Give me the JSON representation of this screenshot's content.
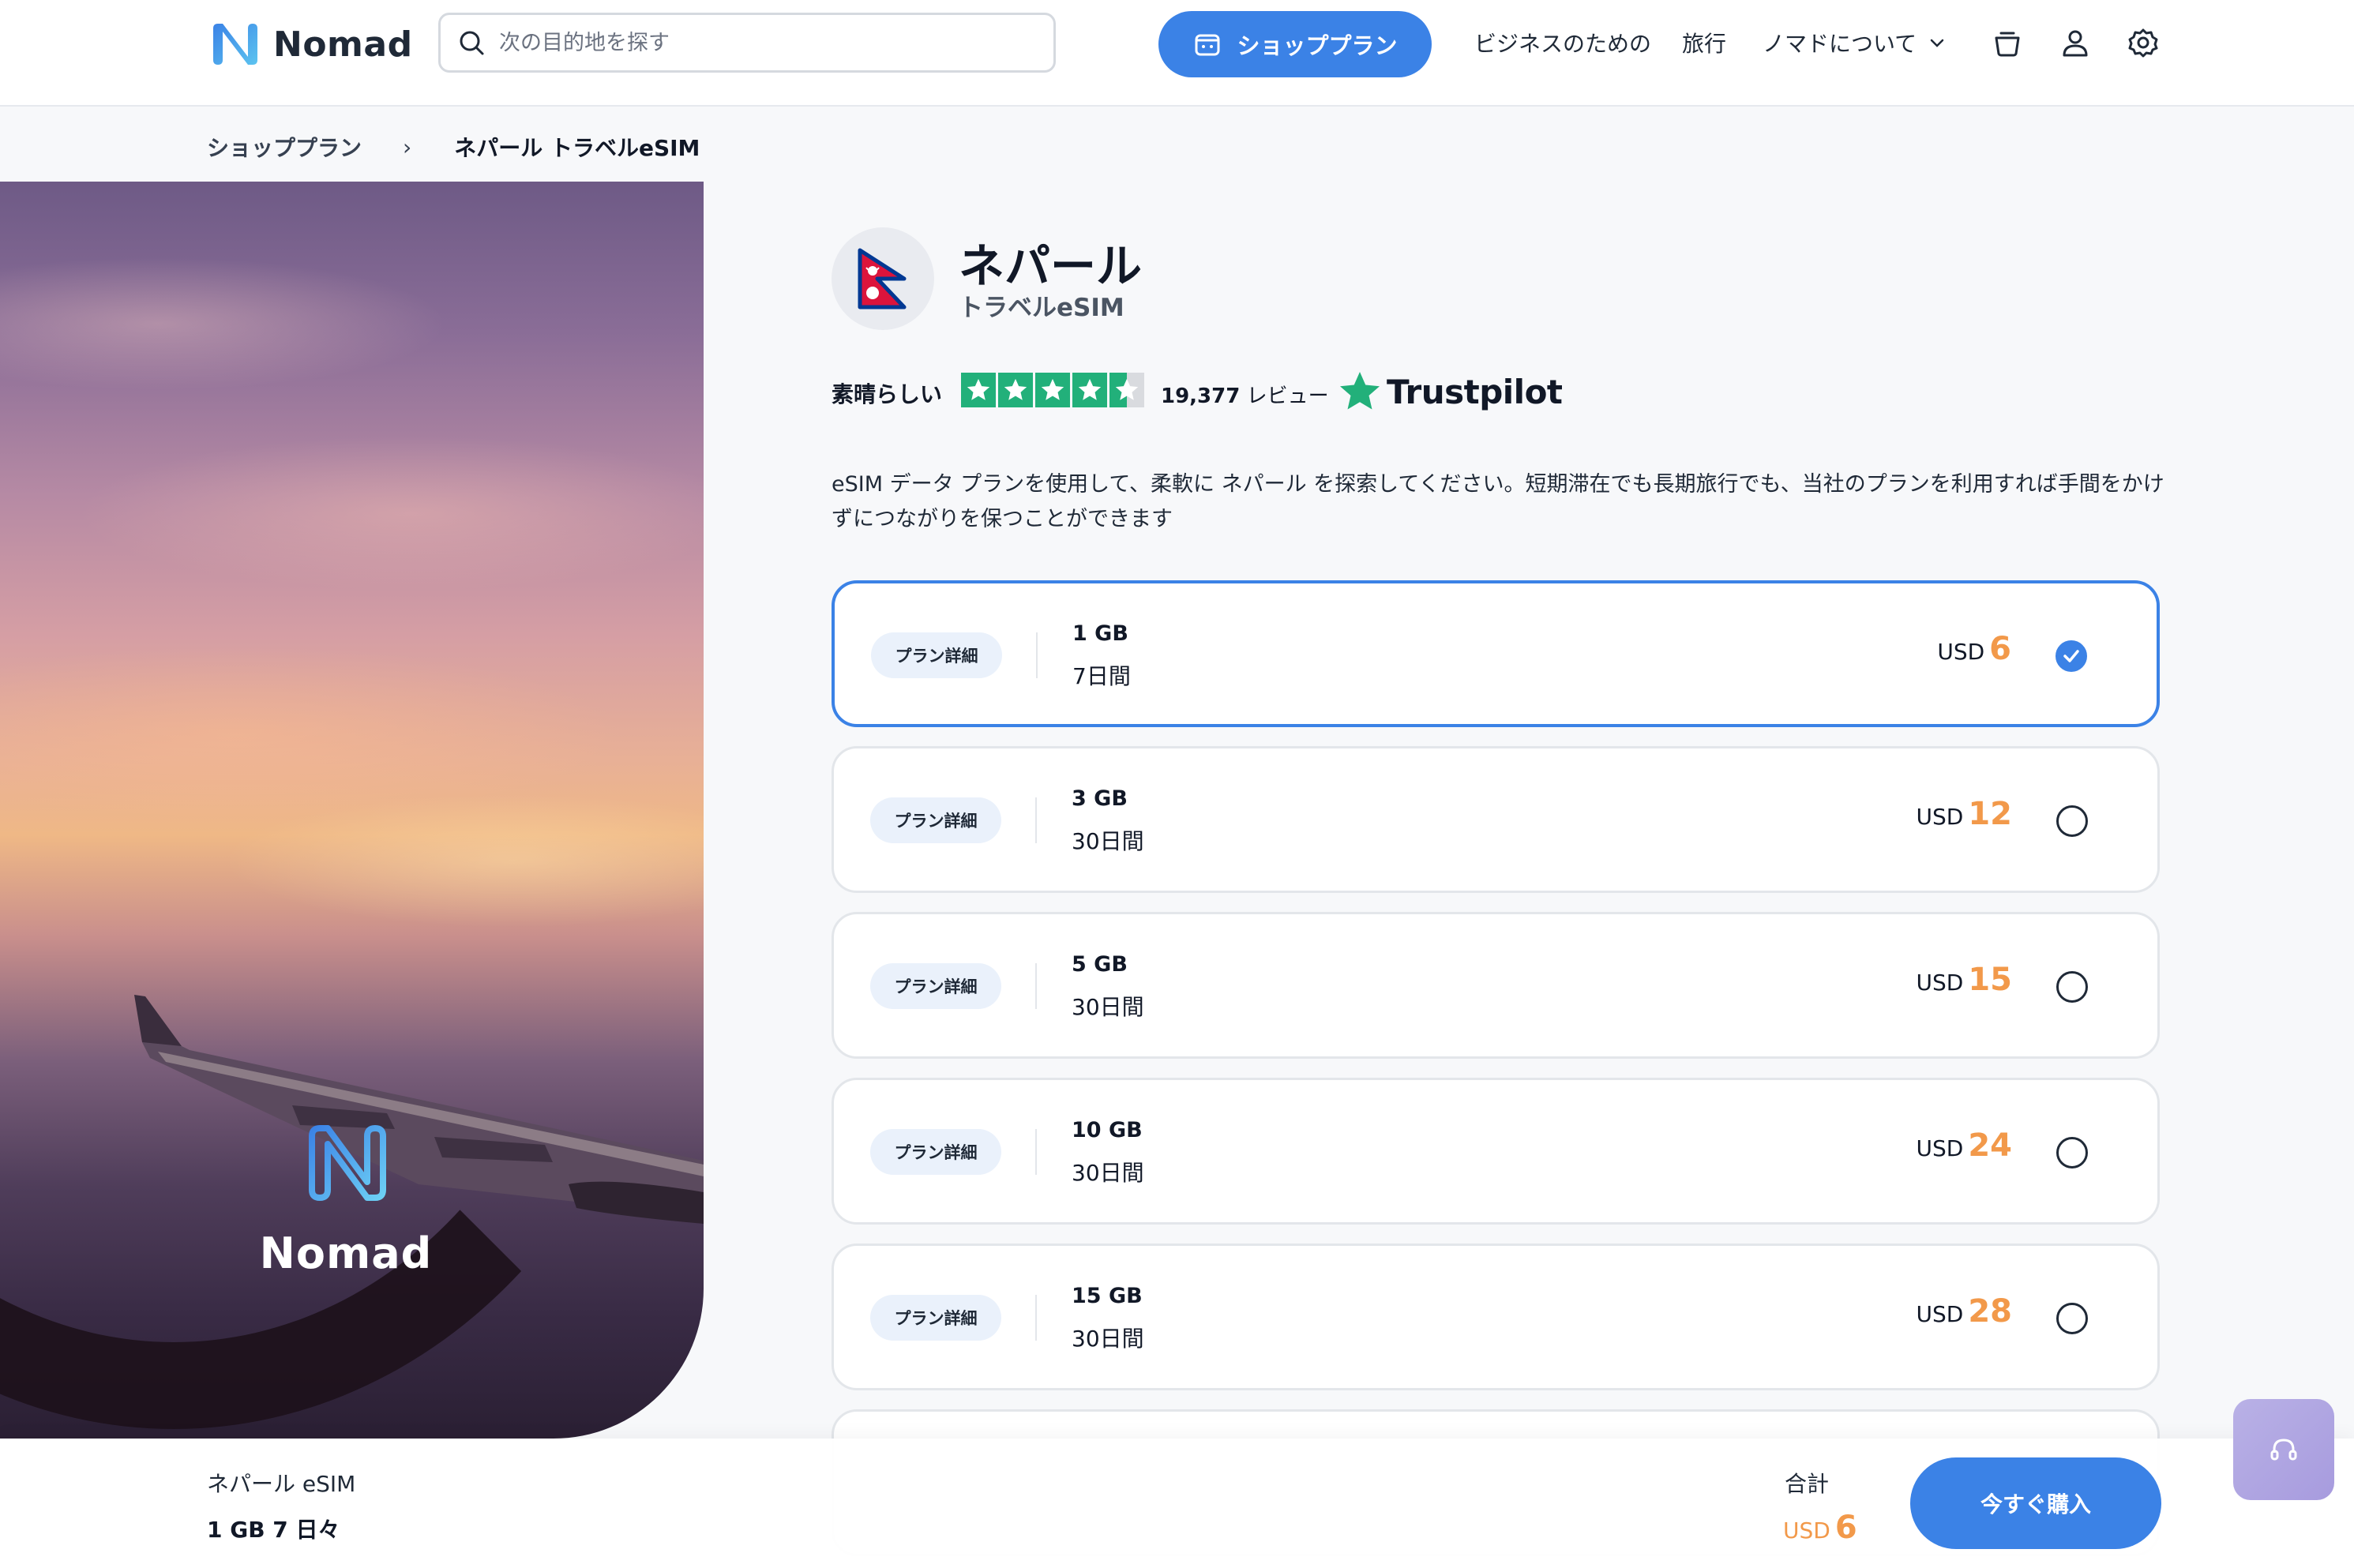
{
  "header": {
    "brand": "Nomad",
    "search_placeholder": "次の目的地を探す",
    "shop_label": "ショッププラン",
    "nav": {
      "business": "ビジネスのための",
      "travel": "旅行",
      "about": "ノマドについて"
    }
  },
  "breadcrumb": {
    "parent": "ショッププラン",
    "separator": "›",
    "current": "ネパール トラベルeSIM"
  },
  "hero": {
    "brand": "Nomad"
  },
  "product": {
    "title": "ネパール",
    "subtitle": "トラベルeSIM",
    "rating_label": "素晴らしい",
    "rating_stars": 4.5,
    "review_count": "19,377",
    "review_suffix": "レビュー",
    "trustpilot": "Trustpilot",
    "description": "eSIM データ プランを使用して、柔軟に ネパール を探索してください。短期滞在でも長期旅行でも、当社のプランを利用すれば手間をかけずにつながりを保つことができます"
  },
  "plans": [
    {
      "badge": "プラン詳細",
      "data": "1 GB",
      "days": "7日間",
      "currency": "USD",
      "price": "6",
      "selected": true
    },
    {
      "badge": "プラン詳細",
      "data": "3 GB",
      "days": "30日間",
      "currency": "USD",
      "price": "12",
      "selected": false
    },
    {
      "badge": "プラン詳細",
      "data": "5 GB",
      "days": "30日間",
      "currency": "USD",
      "price": "15",
      "selected": false
    },
    {
      "badge": "プラン詳細",
      "data": "10 GB",
      "days": "30日間",
      "currency": "USD",
      "price": "24",
      "selected": false
    },
    {
      "badge": "プラン詳細",
      "data": "15 GB",
      "days": "30日間",
      "currency": "USD",
      "price": "28",
      "selected": false
    }
  ],
  "summary": {
    "name": "ネパール eSIM",
    "plan": "1 GB 7 日々",
    "total_label": "合計",
    "currency": "USD",
    "total": "6",
    "buy_label": "今すぐ購入"
  },
  "colors": {
    "accent": "#3b82e6",
    "price": "#f2994a",
    "trustpilot_green": "#22b07a"
  }
}
